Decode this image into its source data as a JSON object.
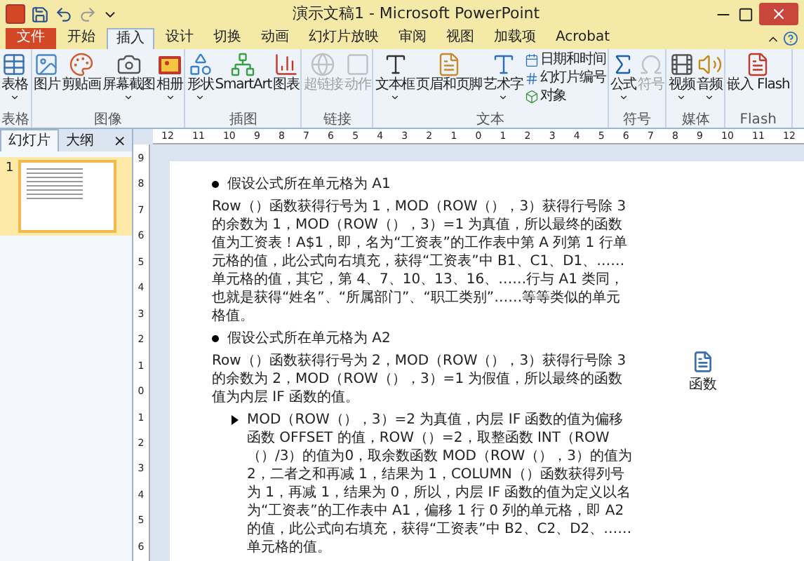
{
  "window": {
    "title": "演示文稿1 - Microsoft PowerPoint"
  },
  "tabs": [
    {
      "label": "文件",
      "kind": "file",
      "selected": false
    },
    {
      "label": "开始",
      "kind": "tab",
      "selected": false
    },
    {
      "label": "插入",
      "kind": "tab",
      "selected": true
    },
    {
      "label": "设计",
      "kind": "tab",
      "selected": false
    },
    {
      "label": "切换",
      "kind": "tab",
      "selected": false
    },
    {
      "label": "动画",
      "kind": "tab",
      "selected": false
    },
    {
      "label": "幻灯片放映",
      "kind": "tab",
      "selected": false
    },
    {
      "label": "审阅",
      "kind": "tab",
      "selected": false
    },
    {
      "label": "视图",
      "kind": "tab",
      "selected": false
    },
    {
      "label": "加载项",
      "kind": "tab",
      "selected": false
    },
    {
      "label": "Acrobat",
      "kind": "tab",
      "selected": false
    }
  ],
  "ribbon_groups": [
    {
      "label": "表格",
      "buttons": [
        {
          "label": "表格",
          "kind": "large",
          "dropdown": true,
          "disabled": false
        }
      ]
    },
    {
      "label": "图像",
      "buttons": [
        {
          "label": "图片",
          "kind": "large",
          "dropdown": false,
          "disabled": false
        },
        {
          "label": "剪贴画",
          "kind": "large",
          "dropdown": false,
          "disabled": false
        },
        {
          "label": "屏幕截图",
          "kind": "large",
          "dropdown": true,
          "disabled": false
        },
        {
          "label": "相册",
          "kind": "large",
          "dropdown": true,
          "disabled": false
        }
      ]
    },
    {
      "label": "插图",
      "buttons": [
        {
          "label": "形状",
          "kind": "large",
          "dropdown": true,
          "disabled": false
        },
        {
          "label": "SmartArt",
          "kind": "large",
          "dropdown": false,
          "disabled": false
        },
        {
          "label": "图表",
          "kind": "large",
          "dropdown": false,
          "disabled": false
        }
      ]
    },
    {
      "label": "链接",
      "buttons": [
        {
          "label": "超链接",
          "kind": "large",
          "dropdown": false,
          "disabled": true
        },
        {
          "label": "动作",
          "kind": "large",
          "dropdown": false,
          "disabled": true
        }
      ]
    },
    {
      "label": "文本",
      "buttons": [
        {
          "label": "文本框",
          "kind": "large",
          "dropdown": true,
          "disabled": false
        },
        {
          "label": "页眉和页脚",
          "kind": "large",
          "dropdown": false,
          "disabled": false
        },
        {
          "label": "艺术字",
          "kind": "large",
          "dropdown": true,
          "disabled": false
        },
        {
          "label": "日期和时间",
          "kind": "small",
          "disabled": false
        },
        {
          "label": "幻灯片编号",
          "kind": "small",
          "disabled": false
        },
        {
          "label": "对象",
          "kind": "small",
          "disabled": false
        }
      ]
    },
    {
      "label": "符号",
      "buttons": [
        {
          "label": "公式",
          "kind": "large",
          "dropdown": true,
          "disabled": false
        },
        {
          "label": "符号",
          "kind": "large",
          "dropdown": false,
          "disabled": true
        }
      ]
    },
    {
      "label": "媒体",
      "buttons": [
        {
          "label": "视频",
          "kind": "large",
          "dropdown": true,
          "disabled": false
        },
        {
          "label": "音频",
          "kind": "large",
          "dropdown": true,
          "disabled": false
        }
      ]
    },
    {
      "label": "Flash",
      "buttons": [
        {
          "label": "嵌入 Flash",
          "kind": "large",
          "dropdown": false,
          "disabled": false
        }
      ]
    }
  ],
  "panel": {
    "tabs": [
      {
        "label": "幻灯片",
        "selected": true
      },
      {
        "label": "大纲",
        "selected": false
      }
    ],
    "close": "×",
    "slides": [
      {
        "number": "1",
        "selected": true
      }
    ]
  },
  "rulers": {
    "horizontal": [
      "12",
      "11",
      "10",
      "9",
      "8",
      "7",
      "6",
      "5",
      "4",
      "3",
      "2",
      "1",
      "0",
      "1",
      "2",
      "3",
      "4",
      "5",
      "6",
      "7",
      "8",
      "9",
      "10",
      "11",
      "12"
    ],
    "vertical": [
      "9",
      "8",
      "7",
      "6",
      "5",
      "4",
      "3",
      "2",
      "1",
      "0",
      "1",
      "2",
      "3",
      "4",
      "5",
      "6"
    ]
  },
  "slide": {
    "paragraphs": [
      {
        "kind": "bullet",
        "text": "假设公式所在单元格为 A1"
      },
      {
        "kind": "text",
        "text": "Row（）函数获得行号为 1，MOD（ROW（），3）获得行号除 3 的余数为 1，MOD（ROW（），3）=1 为真值，所以最终的函数值为工资表！A$1，即，名为“工资表”的工作表中第 A 列第 1 行单元格的值，此公式向右填充，获得“工资表”中 B1、C1、D1、……单元格的值，其它，第 4、7、10、13、16、……行与 A1 类同，也就是获得“姓名”、“所属部门”、“职工类别”……等等类似的单元格值。"
      },
      {
        "kind": "bullet",
        "text": "假设公式所在单元格为 A2"
      },
      {
        "kind": "text",
        "text": "Row（）函数获得行号为 2，MOD（ROW（），3）获得行号除 3 的余数为 2，MOD（ROW（），3）=1 为假值，所以最终的函数值为内层 IF 函数的值。"
      },
      {
        "kind": "arrow",
        "text": "MOD（ROW（），3）=2 为真值，内层 IF 函数的值为偏移函数 OFFSET 的值，ROW（）=2，取整函数 INT（ROW（）/3）的值为0，取余数函数 MOD（ROW（），3）的值为 2，二者之和再减 1，结果为 1，COLUMN（）函数获得列号为 1，再减 1，结果为 0，所以，内层 IF 函数的值为定义以名为“工资表”的工作表中 A1，偏移 1 行 0 列的单元格，即 A2 的值，此公式向右填充，获得“工资表”中 B2、C2、D2、……单元格的值。"
      }
    ],
    "object": {
      "label": "函数"
    }
  }
}
